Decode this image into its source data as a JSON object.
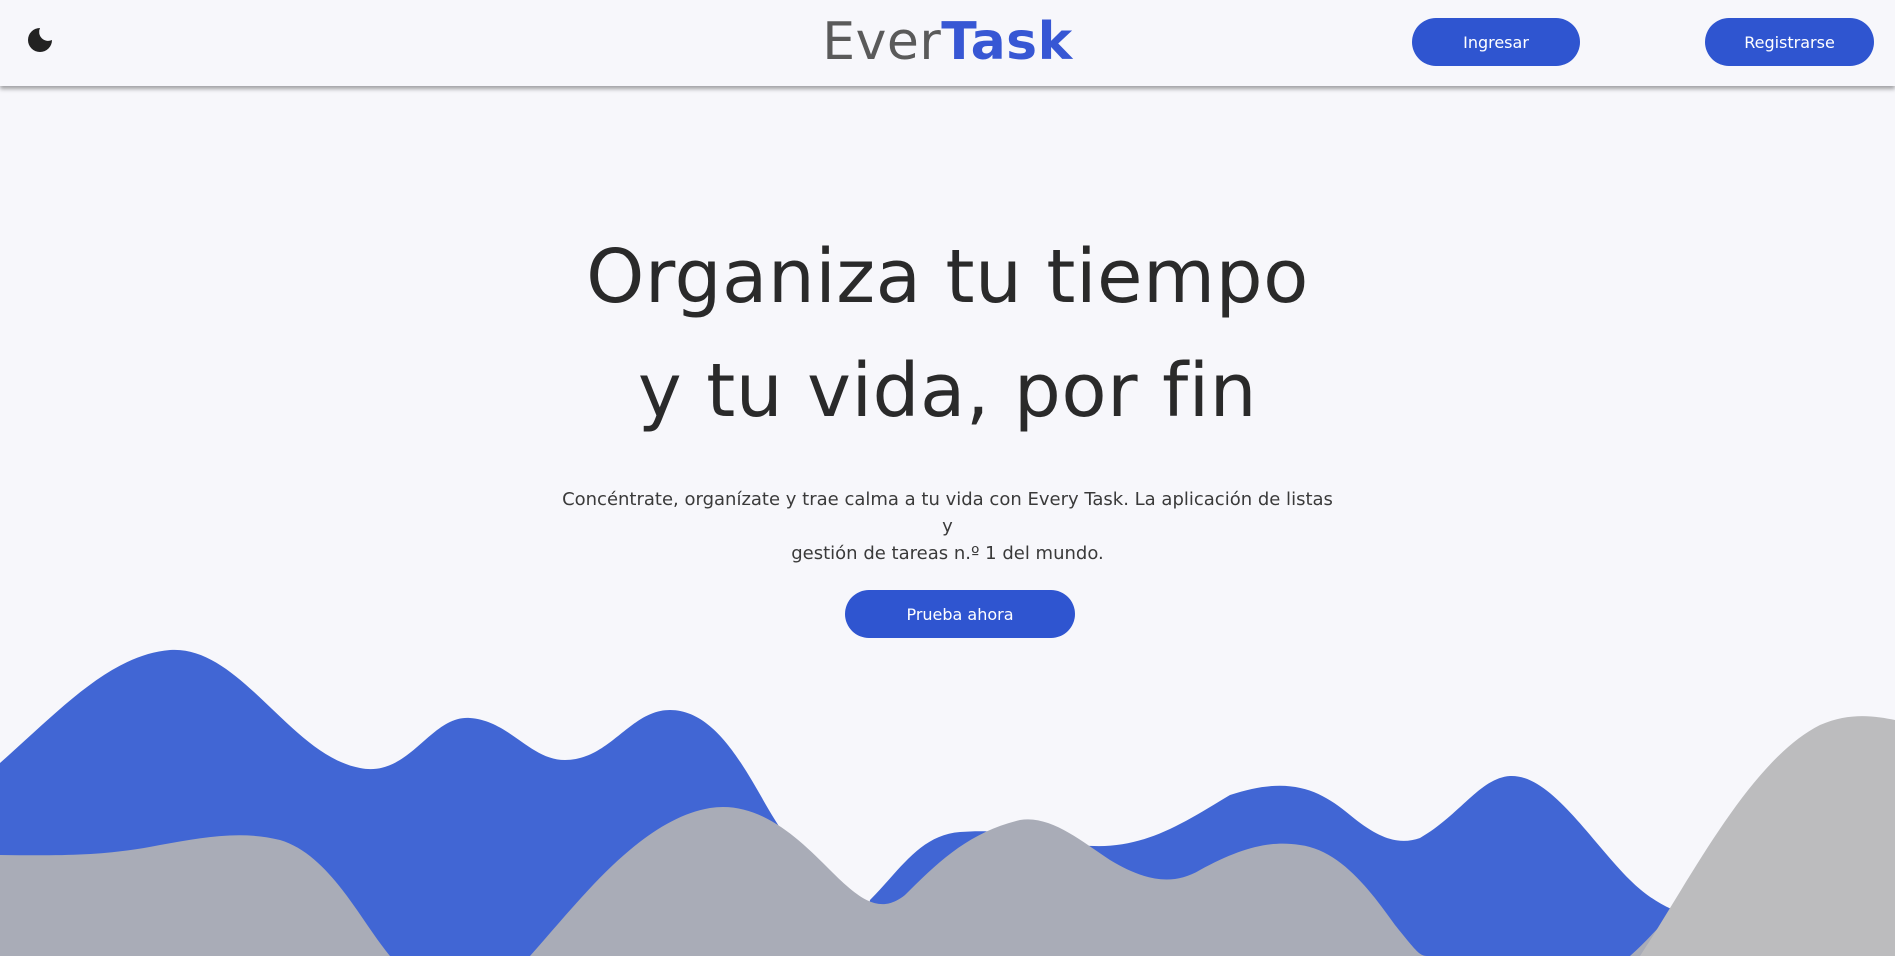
{
  "header": {
    "theme_toggle_icon": "moon-icon",
    "logo_part1": "Ever",
    "logo_part2": "Task",
    "login_label": "Ingresar",
    "register_label": "Registrarse"
  },
  "hero": {
    "title_line1": "Organiza tu tiempo",
    "title_line2": "y tu vida, por fin",
    "subtitle_line1": "Concéntrate, organízate y trae calma a tu vida con Every Task. La aplicación de listas y",
    "subtitle_line2": "gestión de tareas n.º 1 del mundo.",
    "cta_label": "Prueba ahora"
  },
  "colors": {
    "accent": "#2f55d0",
    "logo_accent": "#3757d4",
    "wave_blue": "#4166d4",
    "wave_grey": "#a9acb7",
    "background": "#f7f7fb"
  }
}
